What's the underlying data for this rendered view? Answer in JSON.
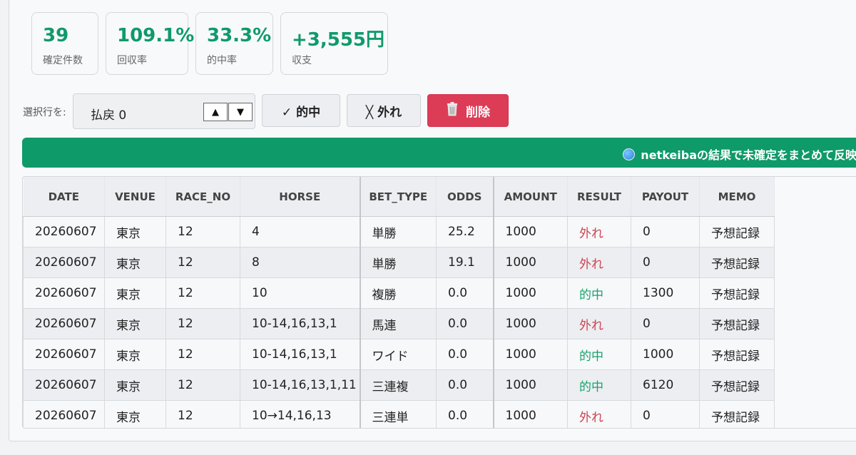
{
  "stats": [
    {
      "value": "39",
      "label": "確定件数"
    },
    {
      "value": "109.1%",
      "label": "回収率"
    },
    {
      "value": "33.3%",
      "label": "的中率"
    },
    {
      "value": "+3,555円",
      "label": "収支"
    }
  ],
  "toolbar": {
    "label": "選択行を:",
    "payout_value": "払戻 0",
    "hit_label": "✓ 的中",
    "miss_label": "╳ 外れ",
    "delete_label": "削除"
  },
  "banner": {
    "label": "netkeibaの結果で未確定をまとめて反映"
  },
  "table": {
    "columns": [
      "DATE",
      "VENUE",
      "RACE_NO",
      "HORSE",
      "BET_TYPE",
      "ODDS",
      "AMOUNT",
      "RESULT",
      "PAYOUT",
      "MEMO"
    ],
    "rows": [
      [
        "20260607",
        "東京",
        "12",
        "4",
        "単勝",
        "25.2",
        "1000",
        "外れ",
        "0",
        "予想記録"
      ],
      [
        "20260607",
        "東京",
        "12",
        "8",
        "単勝",
        "19.1",
        "1000",
        "外れ",
        "0",
        "予想記録"
      ],
      [
        "20260607",
        "東京",
        "12",
        "10",
        "複勝",
        "0.0",
        "1000",
        "的中",
        "1300",
        "予想記録"
      ],
      [
        "20260607",
        "東京",
        "12",
        "10-14,16,13,1",
        "馬連",
        "0.0",
        "1000",
        "外れ",
        "0",
        "予想記録"
      ],
      [
        "20260607",
        "東京",
        "12",
        "10-14,16,13,1",
        "ワイド",
        "0.0",
        "1000",
        "的中",
        "1000",
        "予想記録"
      ],
      [
        "20260607",
        "東京",
        "12",
        "10-14,16,13,1,11",
        "三連複",
        "0.0",
        "1000",
        "的中",
        "6120",
        "予想記録"
      ],
      [
        "20260607",
        "東京",
        "12",
        "10→14,16,13",
        "三連単",
        "0.0",
        "1000",
        "外れ",
        "0",
        "予想記録"
      ]
    ]
  },
  "colors": {
    "accent": "#0f9a6a",
    "danger": "#dd3c57",
    "hit": "#17a36c",
    "miss": "#cc4452"
  }
}
